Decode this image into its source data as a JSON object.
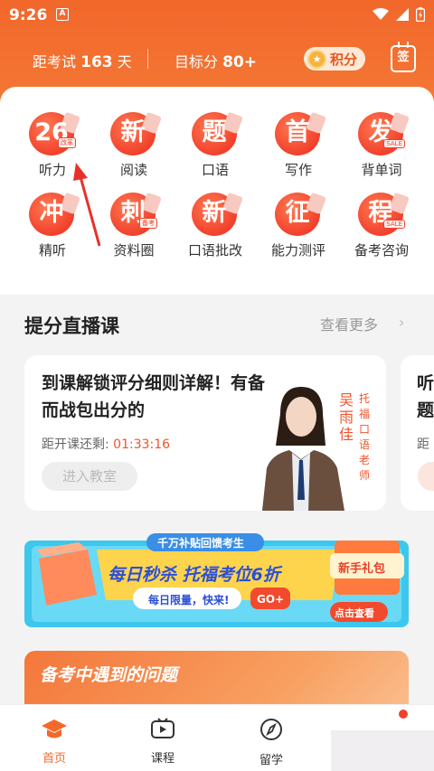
{
  "status_bar": {
    "time": "9:26",
    "app_badge": "A"
  },
  "header": {
    "exam_prefix": "距考试",
    "exam_days": "163",
    "exam_suffix": "天",
    "target_prefix": "目标分",
    "target_score": "80+",
    "points_label": "积分",
    "sign_label": "签"
  },
  "grid": [
    {
      "glyph": "26",
      "label": "听力",
      "mini": "改革"
    },
    {
      "glyph": "新",
      "label": "阅读"
    },
    {
      "glyph": "题",
      "label": "口语"
    },
    {
      "glyph": "首",
      "label": "写作"
    },
    {
      "glyph": "发",
      "label": "背单词",
      "mini": "SALE"
    },
    {
      "glyph": "冲",
      "label": "精听"
    },
    {
      "glyph": "刺",
      "label": "资料圈",
      "mini": "备考"
    },
    {
      "glyph": "新",
      "label": "口语批改"
    },
    {
      "glyph": "征",
      "label": "能力测评"
    },
    {
      "glyph": "程",
      "label": "备考咨询",
      "mini": "SALE"
    }
  ],
  "section": {
    "title": "提分直播课",
    "more": "查看更多"
  },
  "course": {
    "title": "到课解锁评分细则详解！有备而战包出分的",
    "countdown_prefix": "距开课还剩:",
    "countdown": "01:33:16",
    "enter_label": "进入教室",
    "teacher_name": "吴雨佳",
    "teacher_role": "托福口语老师"
  },
  "course2": {
    "title": "听题",
    "countdown": "距"
  },
  "banner": {
    "top_tag": "千万补贴回馈考生",
    "headline": "每日秒杀 托福考位6折",
    "sub": "每日限量，快来!",
    "go": "GO+",
    "gift": "新手礼包",
    "check": "点击查看"
  },
  "problems": {
    "title": "备考中遇到的问题"
  },
  "tabs": [
    {
      "label": "首页",
      "active": true
    },
    {
      "label": "课程",
      "active": false
    },
    {
      "label": "留学",
      "active": false
    }
  ],
  "colors": {
    "brand_orange": "#f26a2b",
    "accent_red": "#f2402c",
    "countdown_red": "#f0532c"
  }
}
